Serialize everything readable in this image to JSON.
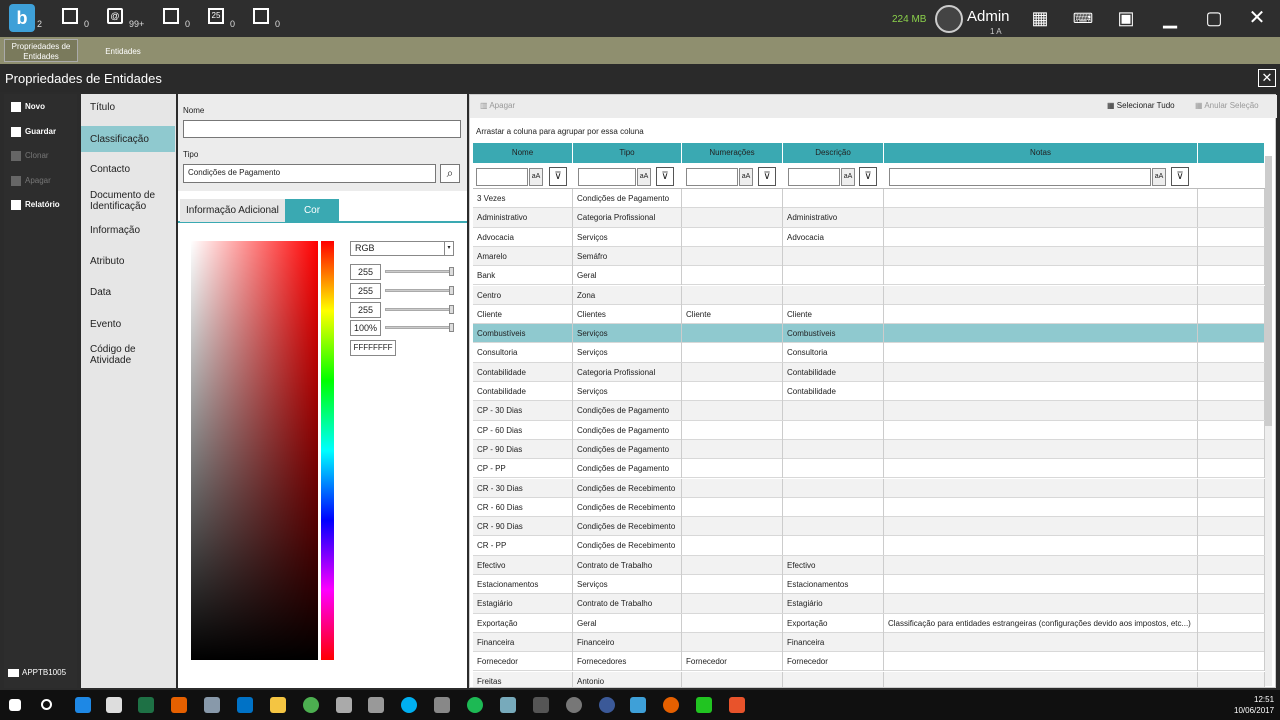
{
  "topbar": {
    "logo_letter": "b",
    "counters": [
      {
        "icon": "notes-icon",
        "count": "2"
      },
      {
        "icon": "new-doc-icon",
        "count": "0"
      },
      {
        "icon": "mail-icon",
        "count": "99+"
      },
      {
        "icon": "window-icon",
        "count": "0"
      },
      {
        "icon": "calendar-icon",
        "count": "0"
      },
      {
        "icon": "message-icon",
        "count": "0"
      }
    ],
    "memory": "224 MB",
    "user": "Admin",
    "user_sub": "1 A"
  },
  "tabs": [
    {
      "label": "Propriedades de Entidades",
      "active": true
    },
    {
      "label": "Entidades",
      "active": false
    }
  ],
  "window": {
    "title": "Propriedades de Entidades",
    "close": "✕"
  },
  "leftbar": {
    "items": [
      {
        "label": "Novo",
        "enabled": true
      },
      {
        "label": "Guardar",
        "enabled": true
      },
      {
        "label": "Clonar",
        "enabled": false
      },
      {
        "label": "Apagar",
        "enabled": false
      },
      {
        "label": "Relatório",
        "enabled": true
      }
    ],
    "footer": "APPTB1005"
  },
  "nav": {
    "items": [
      "Título",
      "Classificação",
      "Contacto",
      "Documento de Identificação",
      "Informação",
      "Atributo",
      "Data",
      "Evento",
      "Código de Atividade"
    ],
    "active_index": 1
  },
  "form": {
    "name_label": "Nome",
    "name_value": "",
    "type_label": "Tipo",
    "type_value": "Condições de Pagamento",
    "subtabs": [
      "Informação Adicional",
      "Cor"
    ],
    "color": {
      "mode": "RGB",
      "r": "255",
      "g": "255",
      "b": "255",
      "alpha": "100%",
      "hex": "FFFFFFFF"
    }
  },
  "grid": {
    "toolbar": {
      "delete": "Apagar",
      "select_all": "Selecionar Tudo",
      "clear_selection": "Anular Seleção"
    },
    "group_hint": "Arrastar a coluna para agrupar por essa coluna",
    "columns": [
      "Nome",
      "Tipo",
      "Numerações",
      "Descrição",
      "Notas"
    ],
    "filter_btn": "aA",
    "rows": [
      [
        "3 Vezes",
        "Condições de Pagamento",
        "",
        "",
        ""
      ],
      [
        "Administrativo",
        "Categoria Profissional",
        "",
        "Administrativo",
        ""
      ],
      [
        "Advocacia",
        "Serviços",
        "",
        "Advocacia",
        ""
      ],
      [
        "Amarelo",
        "Semáfro",
        "",
        "",
        ""
      ],
      [
        "Bank",
        "Geral",
        "",
        "",
        ""
      ],
      [
        "Centro",
        "Zona",
        "",
        "",
        ""
      ],
      [
        "Cliente",
        "Clientes",
        "Cliente",
        "Cliente",
        ""
      ],
      [
        "Combustíveis",
        "Serviços",
        "",
        "Combustíveis",
        ""
      ],
      [
        "Consultoria",
        "Serviços",
        "",
        "Consultoria",
        ""
      ],
      [
        "Contabilidade",
        "Categoria Profissional",
        "",
        "Contabilidade",
        ""
      ],
      [
        "Contabilidade",
        "Serviços",
        "",
        "Contabilidade",
        ""
      ],
      [
        "CP - 30 Dias",
        "Condições de Pagamento",
        "",
        "",
        ""
      ],
      [
        "CP - 60 Dias",
        "Condições de Pagamento",
        "",
        "",
        ""
      ],
      [
        "CP - 90 Dias",
        "Condições de Pagamento",
        "",
        "",
        ""
      ],
      [
        "CP - PP",
        "Condições de Pagamento",
        "",
        "",
        ""
      ],
      [
        "CR - 30 Dias",
        "Condições de Recebimento",
        "",
        "",
        ""
      ],
      [
        "CR - 60 Dias",
        "Condições de Recebimento",
        "",
        "",
        ""
      ],
      [
        "CR - 90 Dias",
        "Condições de Recebimento",
        "",
        "",
        ""
      ],
      [
        "CR - PP",
        "Condições de Recebimento",
        "",
        "",
        ""
      ],
      [
        "Efectivo",
        "Contrato de Trabalho",
        "",
        "Efectivo",
        ""
      ],
      [
        "Estacionamentos",
        "Serviços",
        "",
        "Estacionamentos",
        ""
      ],
      [
        "Estagiário",
        "Contrato de Trabalho",
        "",
        "Estagiário",
        ""
      ],
      [
        "Exportação",
        "Geral",
        "",
        "Exportação",
        "Classificação para entidades estrangeiras (configurações devido aos impostos, etc...)"
      ],
      [
        "Financeira",
        "Financeiro",
        "",
        "Financeira",
        ""
      ],
      [
        "Fornecedor",
        "Fornecedores",
        "Fornecedor",
        "Fornecedor",
        ""
      ],
      [
        "Freitas",
        "Antonio",
        "",
        "",
        ""
      ]
    ],
    "selected_index": 7
  },
  "taskbar": {
    "time": "12:51",
    "date": "10/06/2017"
  }
}
